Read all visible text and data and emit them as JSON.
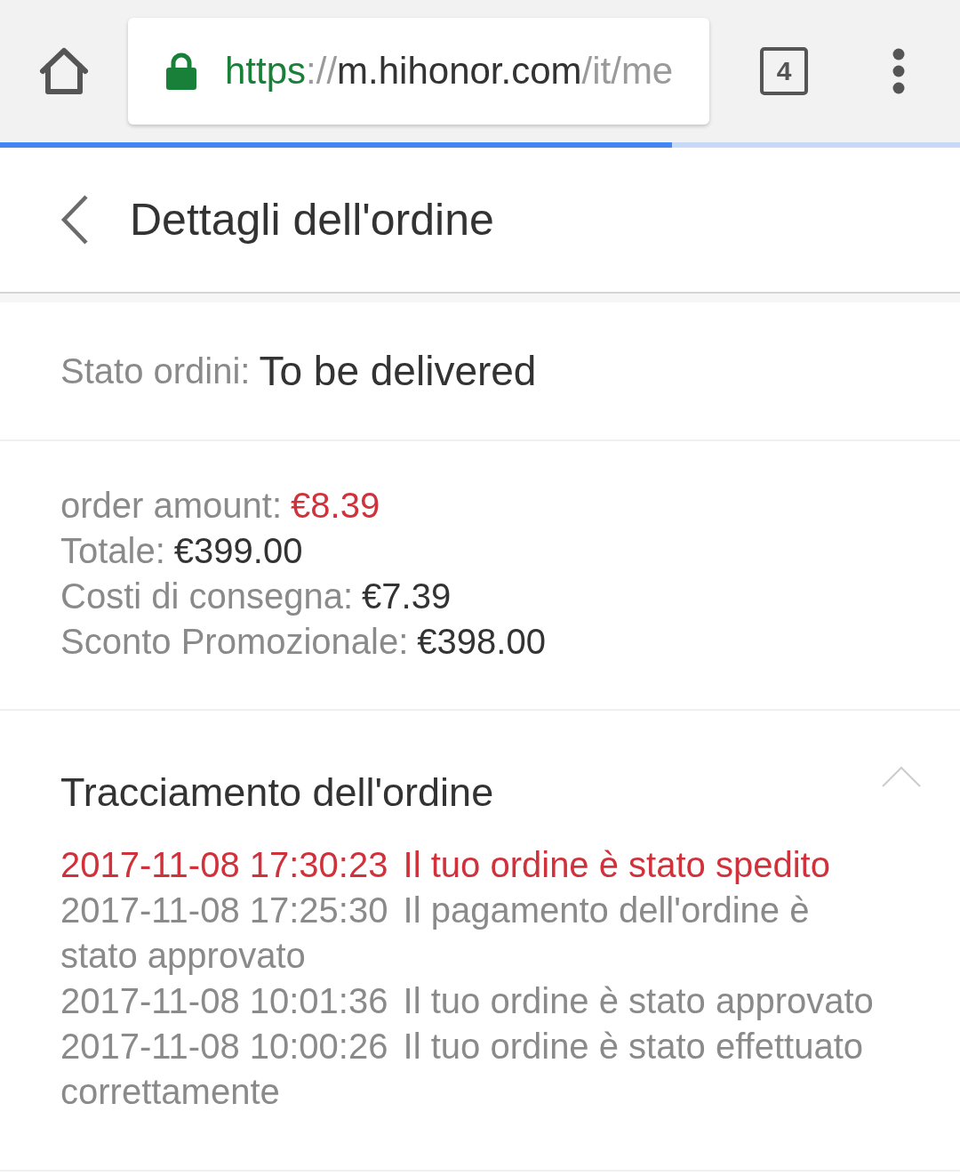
{
  "browser": {
    "url": {
      "scheme": "https",
      "separator": "://",
      "host": "m.hihonor.com",
      "path": "/it/me"
    },
    "tab_count": "4",
    "progress": {
      "level": 0.7
    }
  },
  "header": {
    "title": "Dettagli dell'ordine"
  },
  "order_status": {
    "label": "Stato ordini:",
    "value": "To be delivered"
  },
  "amounts": [
    {
      "label": "order amount:",
      "value": "€8.39",
      "highlighted": true
    },
    {
      "label": "Totale:",
      "value": "€399.00",
      "highlighted": false
    },
    {
      "label": "Costi di consegna:",
      "value": "€7.39",
      "highlighted": false
    },
    {
      "label": "Sconto Promozionale:",
      "value": "€398.00",
      "highlighted": false
    }
  ],
  "tracking": {
    "title": "Tracciamento dell'ordine",
    "expanded": true,
    "events": [
      {
        "time": "2017-11-08 17:30:23",
        "text": "Il tuo ordine è stato spedito",
        "latest": true
      },
      {
        "time": "2017-11-08 17:25:30",
        "text": "Il pagamento dell'ordine è stato approvato",
        "latest": false
      },
      {
        "time": "2017-11-08 10:01:36",
        "text": "Il tuo ordine è stato approvato",
        "latest": false
      },
      {
        "time": "2017-11-08 10:00:26",
        "text": "Il tuo ordine è stato effettuato correttamente",
        "latest": false
      }
    ]
  }
}
